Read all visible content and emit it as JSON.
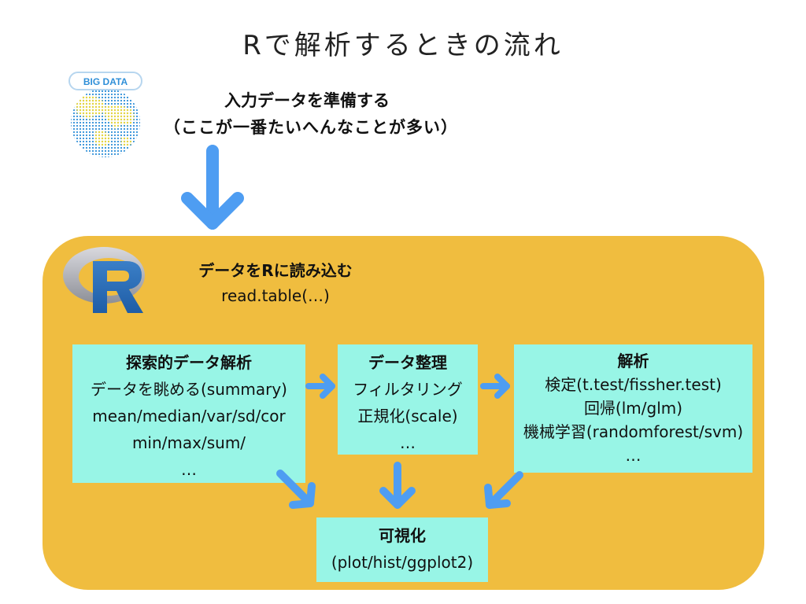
{
  "title": "Rで解析するときの流れ",
  "bigdata": {
    "badge": "BIG DATA"
  },
  "prepare": {
    "line1": "入力データを準備する",
    "line2": "（ここが一番たいへんなことが多い）"
  },
  "read": {
    "line1": "データをRに読み込む",
    "line2": "read.table(…)"
  },
  "boxes": {
    "eda": {
      "heading": "探索的データ解析",
      "lines": [
        "データを眺める(summary)",
        "mean/median/var/sd/cor",
        "min/max/sum/",
        "…"
      ]
    },
    "clean": {
      "heading": "データ整理",
      "lines": [
        "フィルタリング",
        "正規化(scale)",
        "…"
      ]
    },
    "analysis": {
      "heading": "解析",
      "lines": [
        "検定(t.test/fissher.test)",
        "回帰(lm/glm)",
        "機械学習(randomforest/svm)",
        "…"
      ]
    },
    "vis": {
      "heading": "可視化",
      "lines": [
        "(plot/hist/ggplot2)"
      ]
    }
  },
  "colors": {
    "panel": "#f0bd3f",
    "box": "#98f5e6",
    "arrow": "#4e9df2"
  },
  "icons": [
    "big-data-globe-icon",
    "r-logo-icon"
  ]
}
